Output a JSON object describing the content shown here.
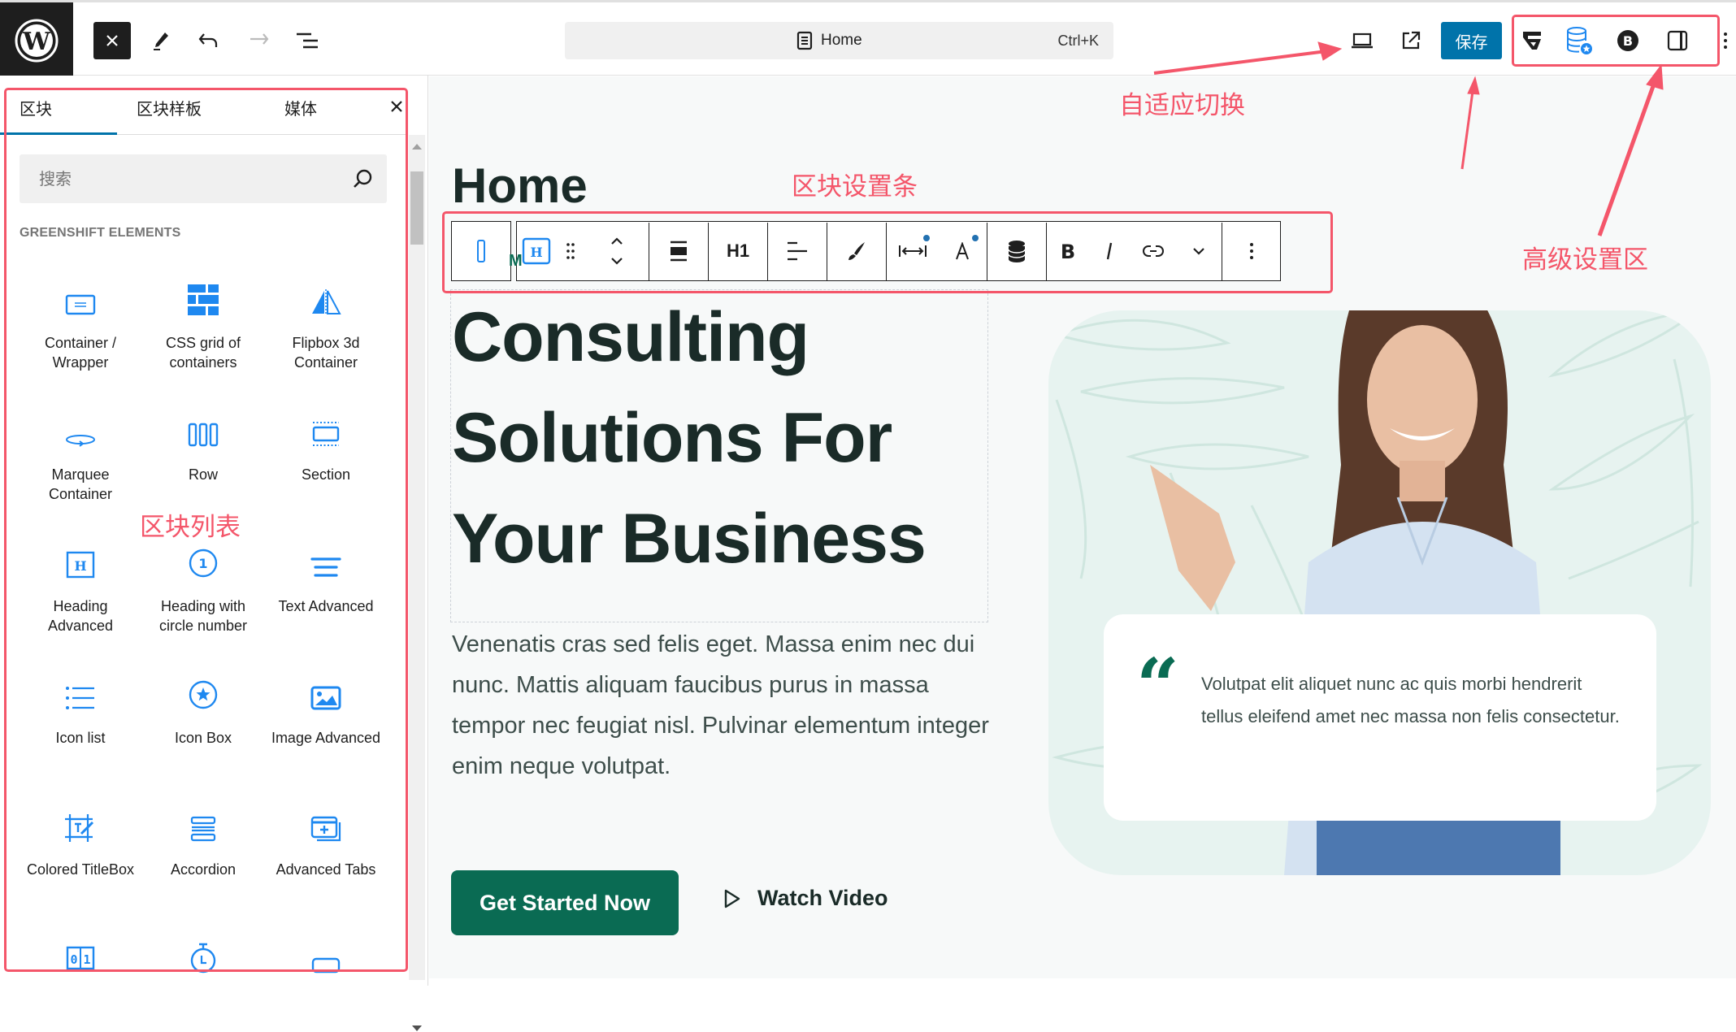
{
  "topbar": {
    "logo": "wordpress-logo",
    "close_inserter_icon": "close-icon",
    "tools": [
      "pencil-icon",
      "undo-icon",
      "redo-icon",
      "document-overview-icon"
    ],
    "command_bar": {
      "icon": "page-icon",
      "title": "Home",
      "shortcut": "Ctrl+K"
    },
    "view_icons": [
      "desktop-preview-icon",
      "external-view-icon"
    ],
    "save_label": "保存",
    "advanced_icons": [
      "greenshift-icon",
      "database-star-icon",
      "b-circle-icon",
      "sidebar-toggle-icon"
    ],
    "more_icon": "vertical-dots-icon"
  },
  "sidebar": {
    "tabs": [
      {
        "label": "区块",
        "active": true
      },
      {
        "label": "区块样板",
        "active": false
      },
      {
        "label": "媒体",
        "active": false
      }
    ],
    "search_placeholder": "搜索",
    "category": "GREENSHIFT ELEMENTS",
    "blocks": [
      {
        "label": "Container / Wrapper",
        "icon": "container-icon"
      },
      {
        "label": "CSS grid of containers",
        "icon": "css-grid-icon"
      },
      {
        "label": "Flipbox 3d Container",
        "icon": "flipbox-icon"
      },
      {
        "label": "Marquee Container",
        "icon": "marquee-icon"
      },
      {
        "label": "Row",
        "icon": "row-icon"
      },
      {
        "label": "Section",
        "icon": "section-icon"
      },
      {
        "label": "Heading Advanced",
        "icon": "heading-icon"
      },
      {
        "label": "Heading with circle number",
        "icon": "circle-number-icon"
      },
      {
        "label": "Text Advanced",
        "icon": "text-align-icon"
      },
      {
        "label": "Icon list",
        "icon": "list-icon"
      },
      {
        "label": "Icon Box",
        "icon": "star-circle-icon"
      },
      {
        "label": "Image Advanced",
        "icon": "image-icon"
      },
      {
        "label": "Colored TitleBox",
        "icon": "titlebox-icon"
      },
      {
        "label": "Accordion",
        "icon": "accordion-icon"
      },
      {
        "label": "Advanced Tabs",
        "icon": "tabs-icon"
      },
      {
        "label": "",
        "icon": "counter-icon"
      },
      {
        "label": "",
        "icon": "timer-icon"
      },
      {
        "label": "",
        "icon": "button-icon"
      }
    ]
  },
  "block_toolbar": {
    "items": [
      "parent-select-icon",
      "heading-block-icon",
      "drag-handle-icon",
      "move-up-down-icon",
      "align-icon",
      "heading-level-h1",
      "text-align-icon",
      "style-brush-icon",
      "spacing-icon",
      "typography-icon",
      "dynamic-data-icon",
      "bold-icon",
      "italic-icon",
      "link-icon",
      "more-chevron-icon",
      "options-icon"
    ],
    "heading_level": "H1"
  },
  "canvas": {
    "page_title": "Home",
    "hero_lines": [
      "Consulting",
      "Solutions For",
      "Your Business"
    ],
    "description": "Venenatis cras sed felis eget. Massa enim nec dui nunc. Mattis aliquam faucibus purus in massa tempor nec feugiat nisl. Pulvinar elementum integer enim neque volutpat.",
    "cta_label": "Get Started Now",
    "watch_label": "Watch Video",
    "quote_mark": "“",
    "quote_text": "Volutpat elit aliquet nunc ac quis morbi hendrerit tellus eleifend amet nec massa non felis consectetur."
  },
  "annotations": {
    "responsive_switch": "自适应切换",
    "block_settings_bar": "区块设置条",
    "advanced_settings": "高级设置区",
    "block_list": "区块列表"
  },
  "colors": {
    "accent": "#0073aa",
    "brand_green": "#0a6b53",
    "annotation_red": "#f4566a",
    "block_icon_blue": "#1e88f0"
  }
}
